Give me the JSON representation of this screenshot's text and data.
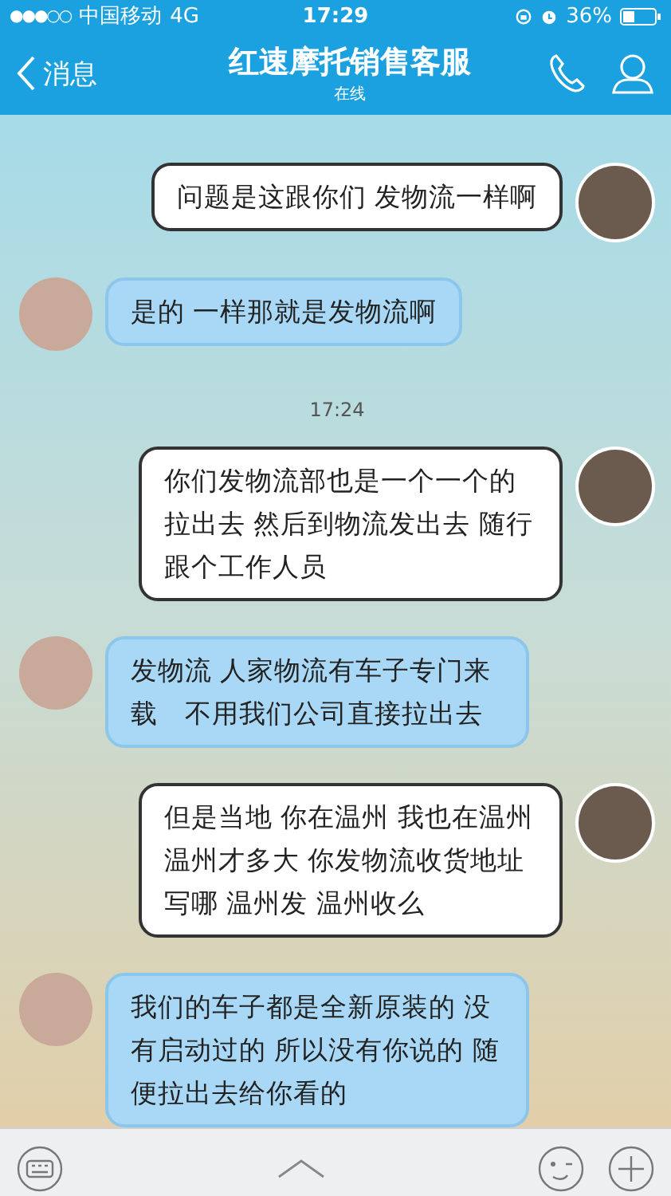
{
  "status_bar": {
    "signal": "●●●○○",
    "carrier": "中国移动",
    "network": "4G",
    "time": "17:29",
    "battery": "36%"
  },
  "header": {
    "back": "消息",
    "title": "红速摩托销售客服",
    "subtitle": "在线"
  },
  "messages": [
    {
      "kind": "sent",
      "text": "问题是这跟你们 发物流一样啊"
    },
    {
      "kind": "received",
      "text": "是的 一样那就是发物流啊"
    },
    {
      "kind": "time",
      "text": "17:24"
    },
    {
      "kind": "sent",
      "text": "你们发物流部也是一个一个的拉出去 然后到物流发出去 随行跟个工作人员"
    },
    {
      "kind": "received",
      "text": "发物流 人家物流有车子专门来载　不用我们公司直接拉出去"
    },
    {
      "kind": "sent",
      "text": "但是当地 你在温州 我也在温州温州才多大 你发物流收货地址写哪 温州发 温州收么"
    },
    {
      "kind": "received",
      "text": "我们的车子都是全新原装的 没有启动过的 所以没有你说的 随便拉出去给你看的"
    }
  ]
}
